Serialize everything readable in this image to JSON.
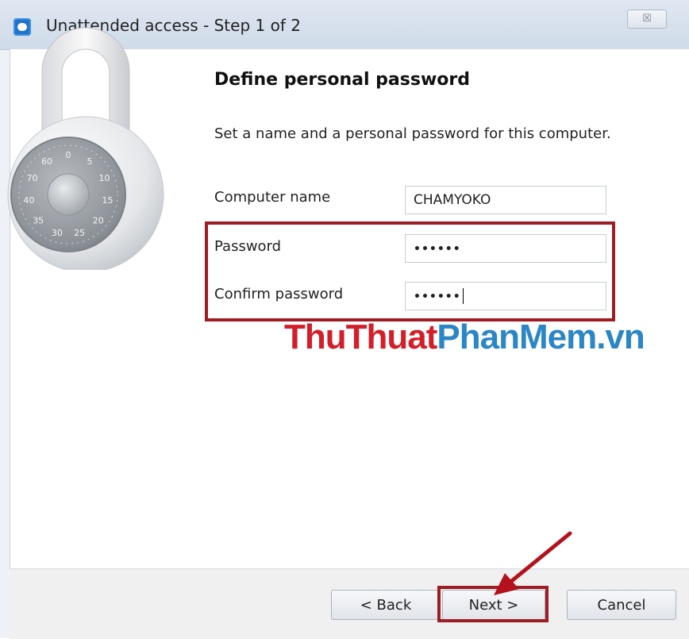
{
  "window": {
    "title": "Unattended access - Step 1 of 2",
    "close_label": "☒"
  },
  "main": {
    "heading": "Define personal password",
    "description": "Set a name and a personal password for this computer."
  },
  "form": {
    "computer_name_label": "Computer name",
    "computer_name_value": "CHAMYOKO",
    "password_label": "Password",
    "password_value": "••••••",
    "confirm_label": "Confirm password",
    "confirm_value": "••••••"
  },
  "watermark": {
    "part1": "ThuThuat",
    "part2": "PhanMem.vn"
  },
  "footer": {
    "back_label": "< Back",
    "next_label": "Next >",
    "cancel_label": "Cancel"
  },
  "colors": {
    "highlight": "#9c1d23",
    "watermark_red": "#d31f2a",
    "watermark_blue": "#2b86c6",
    "app_icon": "#1f73c9"
  },
  "icons": {
    "app": "teamviewer-icon",
    "illustration": "padlock-icon",
    "annotation": "red-arrow-icon"
  },
  "lock_dial_numbers": [
    "0",
    "5",
    "10",
    "15",
    "20",
    "25",
    "30",
    "35",
    "40",
    "70",
    "60"
  ]
}
